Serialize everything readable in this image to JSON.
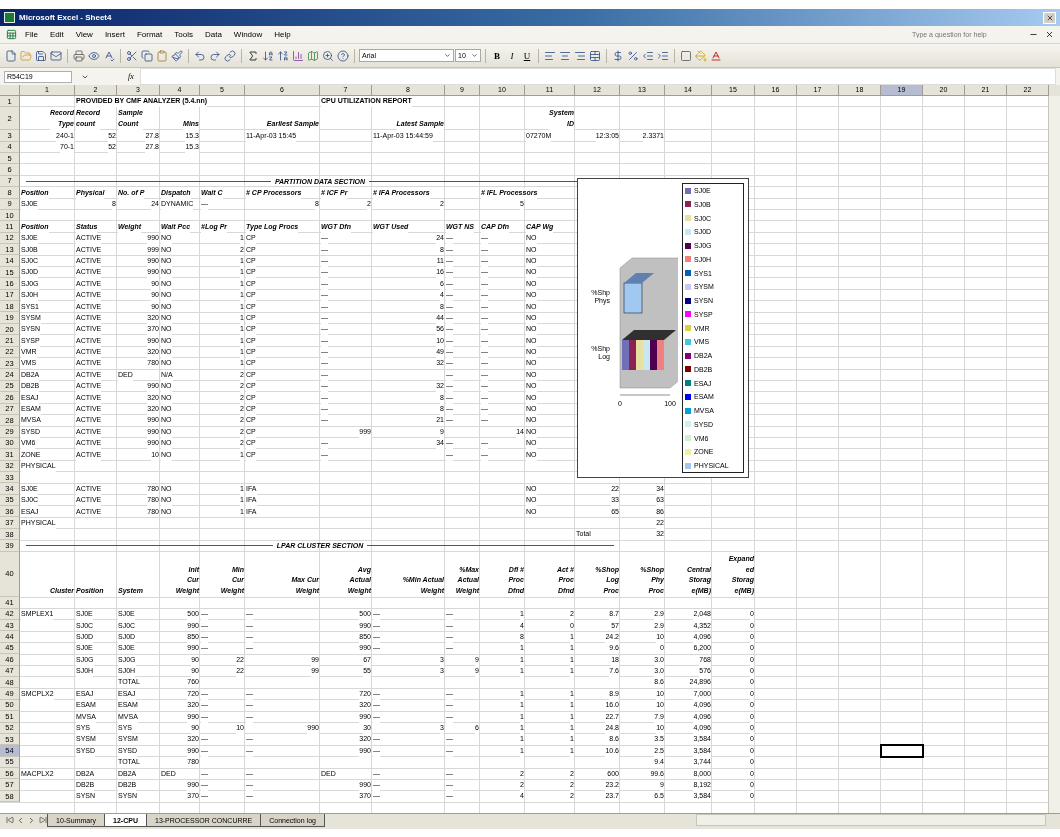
{
  "window": {
    "title": "Microsoft Excel - Sheet4"
  },
  "menu": [
    "File",
    "Edit",
    "View",
    "Insert",
    "Format",
    "Tools",
    "Data",
    "Window",
    "Help"
  ],
  "help": {
    "placeholder": "Type a question for help"
  },
  "format_bar": {
    "font": "Arial",
    "size": "10",
    "style_buttons": [
      "B",
      "I",
      "U"
    ]
  },
  "formula_bar": {
    "name_box": "R54C19",
    "fx": "fx"
  },
  "sheet": {
    "columns": [
      "1",
      "2",
      "3",
      "4",
      "5",
      "6",
      "7",
      "8",
      "9",
      "10",
      "11",
      "12",
      "13",
      "14",
      "15",
      "16",
      "17",
      "18",
      "19",
      "20",
      "21",
      "22"
    ],
    "rows": [
      {
        "number": "1",
        "kind": "title",
        "cells": [
          null,
          "PROVIDED BY CMF ANALYZER (5.4.nn)",
          null,
          null,
          null,
          null,
          "CPU UTILIZATION REPORT"
        ]
      },
      {
        "number": "2",
        "kind": "heading",
        "cells": [
          "Record\nType",
          "Record\ncount",
          "Sample\nCount",
          "Mins",
          null,
          "Earliest Sample",
          null,
          "Latest Sample",
          null,
          null,
          "System\nID"
        ]
      },
      {
        "number": "3",
        "kind": "data",
        "cells": [
          "240-1",
          "52",
          "27.8",
          "15.3",
          null,
          "11-Apr-03 15:45",
          null,
          "11-Apr-03 15:44:59",
          null,
          null,
          "07270M",
          "12:3:05",
          "2.3371"
        ]
      },
      {
        "number": "4",
        "kind": "data",
        "cells": [
          "70-1",
          "52",
          "27.8",
          "15.3"
        ]
      },
      {
        "number": "5",
        "kind": "data"
      },
      {
        "number": "6",
        "kind": "data"
      },
      {
        "number": "7",
        "kind": "section",
        "text": "PARTITION DATA SECTION"
      },
      {
        "number": "8",
        "kind": "caption",
        "cells": [
          "Position",
          "Physical",
          "No. of P",
          "Dispatch",
          "Wait C",
          "# CP Processors",
          "# ICF Pr",
          "# IFA Processors",
          null,
          "# IFL Processors"
        ]
      },
      {
        "number": "9",
        "kind": "data",
        "cells": [
          "SJ0E",
          "8",
          "24",
          "DYNAMIC",
          "—",
          "8",
          "2",
          "2",
          null,
          "5"
        ]
      },
      {
        "number": "10",
        "kind": "data"
      },
      {
        "number": "11",
        "kind": "caption",
        "cells": [
          "Position",
          "Status",
          "Weight",
          "Wait Pcc",
          "#Log Pr",
          "Type Log Procs",
          "WGT Dfn",
          "WGT Used",
          "WGT NS",
          "CAP Dfn",
          "CAP Wg"
        ]
      },
      {
        "number": "12",
        "kind": "data",
        "cells": [
          "SJ0E",
          "ACTIVE",
          "990",
          "NO",
          "1",
          "CP",
          "—",
          "24",
          "—",
          "—",
          "NO"
        ]
      },
      {
        "number": "13",
        "kind": "data",
        "cells": [
          "SJ0B",
          "ACTIVE",
          "999",
          "NO",
          "2",
          "CP",
          "—",
          "8",
          "—",
          "—",
          "NO"
        ]
      },
      {
        "number": "14",
        "kind": "data",
        "cells": [
          "SJ0C",
          "ACTIVE",
          "990",
          "NO",
          "1",
          "CP",
          "—",
          "11",
          "—",
          "—",
          "NO"
        ]
      },
      {
        "number": "15",
        "kind": "data",
        "cells": [
          "SJ0D",
          "ACTIVE",
          "990",
          "NO",
          "1",
          "CP",
          "—",
          "16",
          "—",
          "—",
          "NO"
        ]
      },
      {
        "number": "16",
        "kind": "data",
        "cells": [
          "SJ0G",
          "ACTIVE",
          "90",
          "NO",
          "1",
          "CP",
          "—",
          "6",
          "—",
          "—",
          "NO"
        ]
      },
      {
        "number": "17",
        "kind": "data",
        "cells": [
          "SJ0H",
          "ACTIVE",
          "90",
          "NO",
          "1",
          "CP",
          "—",
          "4",
          "—",
          "—",
          "NO"
        ]
      },
      {
        "number": "18",
        "kind": "data",
        "cells": [
          "SYS1",
          "ACTIVE",
          "90",
          "NO",
          "1",
          "CP",
          "—",
          "8",
          "—",
          "—",
          "NO"
        ]
      },
      {
        "number": "19",
        "kind": "data",
        "cells": [
          "SYSM",
          "ACTIVE",
          "320",
          "NO",
          "1",
          "CP",
          "—",
          "44",
          "—",
          "—",
          "NO"
        ]
      },
      {
        "number": "20",
        "kind": "data",
        "cells": [
          "SYSN",
          "ACTIVE",
          "370",
          "NO",
          "1",
          "CP",
          "—",
          "56",
          "—",
          "—",
          "NO"
        ]
      },
      {
        "number": "21",
        "kind": "data",
        "cells": [
          "SYSP",
          "ACTIVE",
          "990",
          "NO",
          "1",
          "CP",
          "—",
          "10",
          "—",
          "—",
          "NO"
        ]
      },
      {
        "number": "22",
        "kind": "data",
        "cells": [
          "VMR",
          "ACTIVE",
          "320",
          "NO",
          "1",
          "CP",
          "—",
          "49",
          "—",
          "—",
          "NO"
        ]
      },
      {
        "number": "23",
        "kind": "data",
        "cells": [
          "VMS",
          "ACTIVE",
          "780",
          "NO",
          "1",
          "CP",
          "—",
          "32",
          "—",
          "—",
          "NO"
        ]
      },
      {
        "number": "24",
        "kind": "data",
        "cells": [
          "DB2A",
          "ACTIVE",
          "DED",
          "N/A",
          "2",
          "CP",
          "—",
          null,
          "—",
          "—",
          "NO"
        ]
      },
      {
        "number": "25",
        "kind": "data",
        "cells": [
          "DB2B",
          "ACTIVE",
          "990",
          "NO",
          "2",
          "CP",
          "—",
          "32",
          "—",
          "—",
          "NO"
        ]
      },
      {
        "number": "26",
        "kind": "data",
        "cells": [
          "ESAJ",
          "ACTIVE",
          "320",
          "NO",
          "2",
          "CP",
          "—",
          "8",
          "—",
          "—",
          "NO"
        ]
      },
      {
        "number": "27",
        "kind": "data",
        "cells": [
          "ESAM",
          "ACTIVE",
          "320",
          "NO",
          "2",
          "CP",
          "—",
          "8",
          "—",
          "—",
          "NO"
        ]
      },
      {
        "number": "28",
        "kind": "data",
        "cells": [
          "MVSA",
          "ACTIVE",
          "990",
          "NO",
          "2",
          "CP",
          "—",
          "21",
          "—",
          "—",
          "NO"
        ]
      },
      {
        "number": "29",
        "kind": "data",
        "cells": [
          "SYSD",
          "ACTIVE",
          "990",
          "NO",
          "2",
          "CP",
          "999",
          "9",
          null,
          "14",
          "NO"
        ]
      },
      {
        "number": "30",
        "kind": "data",
        "cells": [
          "VM6",
          "ACTIVE",
          "990",
          "NO",
          "2",
          "CP",
          "—",
          "34",
          "—",
          "—",
          "NO"
        ]
      },
      {
        "number": "31",
        "kind": "data",
        "cells": [
          "ZONE",
          "ACTIVE",
          "10",
          "NO",
          "1",
          "CP",
          "—",
          null,
          "—",
          "—",
          "NO"
        ]
      },
      {
        "number": "32",
        "kind": "data",
        "cells": [
          "PHYSICAL"
        ]
      },
      {
        "number": "33",
        "kind": "data"
      },
      {
        "number": "34",
        "kind": "data",
        "cells": [
          "SJ0E",
          "ACTIVE",
          "780",
          "NO",
          "1",
          "IFA",
          null,
          null,
          null,
          null,
          "NO",
          "22",
          "34"
        ]
      },
      {
        "number": "35",
        "kind": "data",
        "cells": [
          "SJ0C",
          "ACTIVE",
          "780",
          "NO",
          "1",
          "IFA",
          null,
          null,
          null,
          null,
          "NO",
          "33",
          "63"
        ]
      },
      {
        "number": "36",
        "kind": "data",
        "cells": [
          "ESAJ",
          "ACTIVE",
          "780",
          "NO",
          "1",
          "IFA",
          null,
          null,
          null,
          null,
          "NO",
          "65",
          "86"
        ]
      },
      {
        "number": "37",
        "kind": "data",
        "cells": [
          "PHYSICAL",
          null,
          null,
          null,
          null,
          null,
          null,
          null,
          null,
          null,
          null,
          null,
          "22"
        ]
      },
      {
        "number": "38",
        "kind": "data",
        "cells": [
          null,
          null,
          null,
          null,
          null,
          null,
          null,
          null,
          null,
          null,
          null,
          "Total",
          "32"
        ]
      },
      {
        "number": "39",
        "kind": "section",
        "text": "LPAR CLUSTER SECTION"
      },
      {
        "number": "40",
        "kind": "heading",
        "cells": [
          "Cluster",
          "Position",
          "System",
          "Init\nCur\nWeight",
          "Min\nCur\nWeight",
          "Max Cur\nWeight",
          "Avg\nActual\nWeight",
          "%Min Actual\nWeight",
          "%Max\nActual\nWeight",
          "Dfl #\nProc\nDfnd",
          "Act #\nProc\nDfnd",
          "%Shop\nLog\nProc",
          "%Shop\nPhy\nProc",
          "Central\nStorag\ne(MB)",
          "Expand\ned\nStorag\ne(MB)"
        ]
      },
      {
        "number": "41",
        "kind": "data"
      },
      {
        "number": "42",
        "kind": "data",
        "cells": [
          "SMPLEX1",
          "SJ0E",
          "SJ0E",
          "500",
          "—",
          "—",
          "500",
          "—",
          "—",
          "1",
          "2",
          "8.7",
          "2.9",
          "2,048",
          "0"
        ]
      },
      {
        "number": "43",
        "kind": "data",
        "cells": [
          null,
          "SJ0C",
          "SJ0C",
          "990",
          "—",
          "—",
          "990",
          "—",
          "—",
          "4",
          "0",
          "57",
          "2.9",
          "4,352",
          "0"
        ]
      },
      {
        "number": "44",
        "kind": "data",
        "cells": [
          null,
          "SJ0D",
          "SJ0D",
          "850",
          "—",
          "—",
          "850",
          "—",
          "—",
          "8",
          "1",
          "24.2",
          "10",
          "4,096",
          "0"
        ]
      },
      {
        "number": "45",
        "kind": "data",
        "cells": [
          null,
          "SJ0E",
          "SJ0E",
          "990",
          "—",
          "—",
          "990",
          "—",
          "—",
          "1",
          "1",
          "9.6",
          "0",
          "6,200",
          "0"
        ]
      },
      {
        "number": "46",
        "kind": "data",
        "cells": [
          null,
          "SJ0G",
          "SJ0G",
          "90",
          "22",
          "99",
          "67",
          "3",
          "9",
          "1",
          "1",
          "18",
          "3.0",
          "768",
          "0"
        ]
      },
      {
        "number": "47",
        "kind": "data",
        "cells": [
          null,
          "SJ0H",
          "SJ0H",
          "90",
          "22",
          "99",
          "55",
          "3",
          "9",
          "1",
          "1",
          "7.6",
          "3.0",
          "576",
          "0"
        ]
      },
      {
        "number": "48",
        "kind": "data",
        "cells": [
          null,
          null,
          "TOTAL",
          "760",
          null,
          null,
          null,
          null,
          null,
          null,
          null,
          null,
          "8.6",
          "24,896",
          "0"
        ]
      },
      {
        "number": "49",
        "kind": "data",
        "cells": [
          "SMCPLX2",
          "ESAJ",
          "ESAJ",
          "720",
          "—",
          "—",
          "720",
          "—",
          "—",
          "1",
          "1",
          "8.9",
          "10",
          "7,000",
          "0"
        ]
      },
      {
        "number": "50",
        "kind": "data",
        "cells": [
          null,
          "ESAM",
          "ESAM",
          "320",
          "—",
          "—",
          "320",
          "—",
          "—",
          "1",
          "1",
          "16.0",
          "10",
          "4,096",
          "0"
        ]
      },
      {
        "number": "51",
        "kind": "data",
        "cells": [
          null,
          "MVSA",
          "MVSA",
          "990",
          "—",
          "—",
          "990",
          "—",
          "—",
          "1",
          "1",
          "22.7",
          "7.9",
          "4,096",
          "0"
        ]
      },
      {
        "number": "52",
        "kind": "data",
        "cells": [
          null,
          "SYS",
          "SYS",
          "90",
          "10",
          "990",
          "30",
          "3",
          "6",
          "1",
          "1",
          "24.8",
          "10",
          "4,096",
          "0"
        ]
      },
      {
        "number": "53",
        "kind": "data",
        "cells": [
          null,
          "SYSM",
          "SYSM",
          "320",
          "—",
          "—",
          "320",
          "—",
          "—",
          "1",
          "1",
          "8.6",
          "3.5",
          "3,584",
          "0"
        ]
      },
      {
        "number": "54",
        "kind": "data",
        "cells": [
          null,
          "SYSD",
          "SYSD",
          "990",
          "—",
          "—",
          "990",
          "—",
          "—",
          "1",
          "1",
          "10.6",
          "2.5",
          "3,584",
          "0",
          null,
          null,
          null,
          {
            "selected": true
          }
        ]
      },
      {
        "number": "55",
        "kind": "data",
        "cells": [
          null,
          null,
          "TOTAL",
          "780",
          null,
          null,
          null,
          null,
          null,
          null,
          null,
          null,
          "9.4",
          "3,744",
          "0"
        ]
      },
      {
        "number": "56",
        "kind": "data",
        "cells": [
          "MACPLX2",
          "DB2A",
          "DB2A",
          "DED",
          "—",
          "—",
          "DED",
          "—",
          "—",
          "2",
          "2",
          "600",
          "99.6",
          "8,000",
          "0"
        ]
      },
      {
        "number": "57",
        "kind": "data",
        "cells": [
          null,
          "DB2B",
          "DB2B",
          "990",
          "—",
          "—",
          "990",
          "—",
          "—",
          "2",
          "2",
          "23.2",
          "9",
          "8,192",
          "0"
        ]
      },
      {
        "number": "58",
        "kind": "data",
        "cells": [
          null,
          "SYSN",
          "SYSN",
          "370",
          "—",
          "—",
          "370",
          "—",
          "—",
          "4",
          "2",
          "23.7",
          "6.5",
          "3,584",
          "0"
        ]
      }
    ]
  },
  "chart": {
    "categories": [
      "%Shp\nPhys",
      "%Shp\nLog"
    ],
    "ticks": [
      "0",
      "100"
    ],
    "legend": [
      {
        "name": "SJ0E",
        "color": "#7070b8"
      },
      {
        "name": "SJ0B",
        "color": "#8a2252"
      },
      {
        "name": "SJ0C",
        "color": "#e8e0a0"
      },
      {
        "name": "SJ0D",
        "color": "#c8e8f0"
      },
      {
        "name": "SJ0G",
        "color": "#500050"
      },
      {
        "name": "SJ0H",
        "color": "#f08080"
      },
      {
        "name": "SYS1",
        "color": "#0060c0"
      },
      {
        "name": "SYSM",
        "color": "#c8c8f0"
      },
      {
        "name": "SYSN",
        "color": "#000080"
      },
      {
        "name": "SYSP",
        "color": "#ff00ff"
      },
      {
        "name": "VMR",
        "color": "#d8d040"
      },
      {
        "name": "VMS",
        "color": "#40c8e0"
      },
      {
        "name": "DB2A",
        "color": "#800080"
      },
      {
        "name": "DB2B",
        "color": "#800000"
      },
      {
        "name": "ESAJ",
        "color": "#008080"
      },
      {
        "name": "ESAM",
        "color": "#0000ff"
      },
      {
        "name": "MVSA",
        "color": "#00a0e0"
      },
      {
        "name": "SYSD",
        "color": "#d0f0f0"
      },
      {
        "name": "VM6",
        "color": "#d0f0d0"
      },
      {
        "name": "ZONE",
        "color": "#f0f0a0"
      },
      {
        "name": "PHYSICAL",
        "color": "#a0c8f0"
      }
    ]
  },
  "sheet_tabs": [
    {
      "label": "10-Summary",
      "selected": false
    },
    {
      "label": "12-CPU",
      "selected": true
    },
    {
      "label": "13-PROCESSOR CONCURRE",
      "selected": false
    },
    {
      "label": "Connection log",
      "selected": false
    }
  ]
}
